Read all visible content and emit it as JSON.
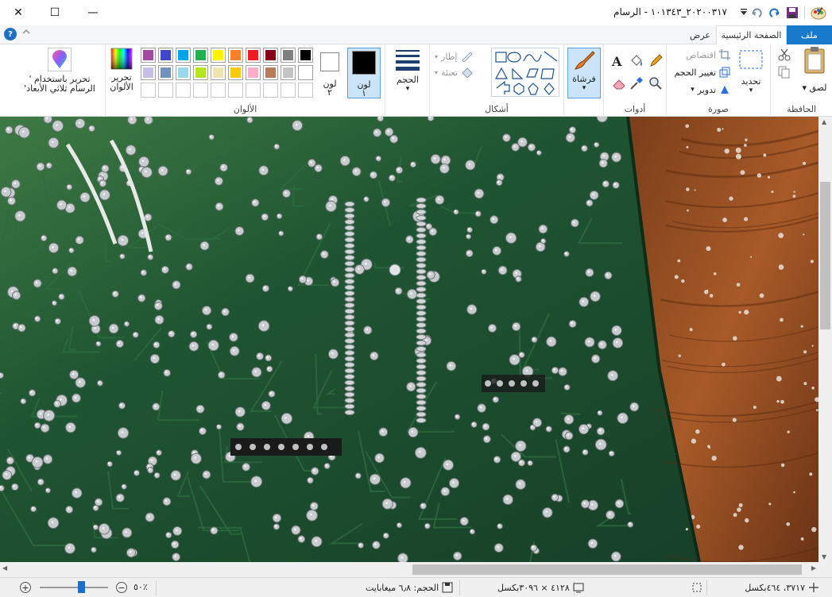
{
  "window": {
    "title": "‏٢٠٢٠٠٣١٧_١٠١٣٤٣ - الرسام",
    "minimize_label": "—",
    "maximize_label": "☐",
    "close_label": "✕"
  },
  "tabs": {
    "file": "ملف",
    "home": "الصفحة الرئيسية",
    "view": "عرض",
    "help": "?"
  },
  "ribbon": {
    "clipboard": {
      "group_label": "الحافظة",
      "paste_label": "لصق"
    },
    "image": {
      "group_label": "صورة",
      "select_label": "تحديد",
      "crop_label": "اقتصاص",
      "resize_label": "تغيير الحجم",
      "rotate_label": "تدوير"
    },
    "tools": {
      "group_label": "أدوات"
    },
    "brushes": {
      "label": "فرشاة"
    },
    "shapes": {
      "group_label": "أشكال",
      "outline_label": "إطار",
      "fill_label": "تعبئة"
    },
    "size": {
      "label": "الحجم"
    },
    "colors": {
      "group_label": "الألوان",
      "color1_label": "لون",
      "color1_num": "١",
      "color2_label": "لون",
      "color2_num": "٢",
      "edit_colors_label": "تحرير الألوان",
      "edit_3d_label": "تحرير باستخدام ' الرسام ثلاثي الأبعاد'",
      "color1_value": "#000000",
      "color2_value": "#ffffff",
      "palette_row1": [
        "#000000",
        "#7f7f7f",
        "#880015",
        "#ed1c24",
        "#ff7f27",
        "#fff200",
        "#22b14c",
        "#00a2e8",
        "#3f48cc",
        "#a349a4"
      ],
      "palette_row2": [
        "#ffffff",
        "#c3c3c3",
        "#b97a57",
        "#ffaec9",
        "#ffc90e",
        "#efe4b0",
        "#b5e61d",
        "#99d9ea",
        "#7092be",
        "#c8bfe7"
      ]
    }
  },
  "status": {
    "cursor_pos": "٣٧١٧، ٤٦٤بكسل",
    "image_size": "٤١٢٨ × ٣٠٩٦بكسل",
    "file_size": "الحجم: ٦٫٨ ميغابايت",
    "zoom": "٥٠٪",
    "zoom_level": 0.6
  }
}
